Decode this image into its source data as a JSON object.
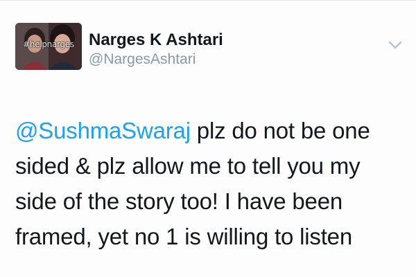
{
  "tweet": {
    "author": {
      "display_name": "Narges K Ashtari",
      "handle": "@NargesAshtari",
      "avatar_tag": "#helpnarges"
    },
    "menu_icon": "chevron-down-icon",
    "mention": "@SushmaSwaraj",
    "text": " plz do not be one sided & plz allow me to tell you my side of the story too! I have been framed, yet no 1 is willing to listen"
  },
  "colors": {
    "mention": "#1da1f2",
    "handle": "#8899a6",
    "text": "#14171a"
  }
}
